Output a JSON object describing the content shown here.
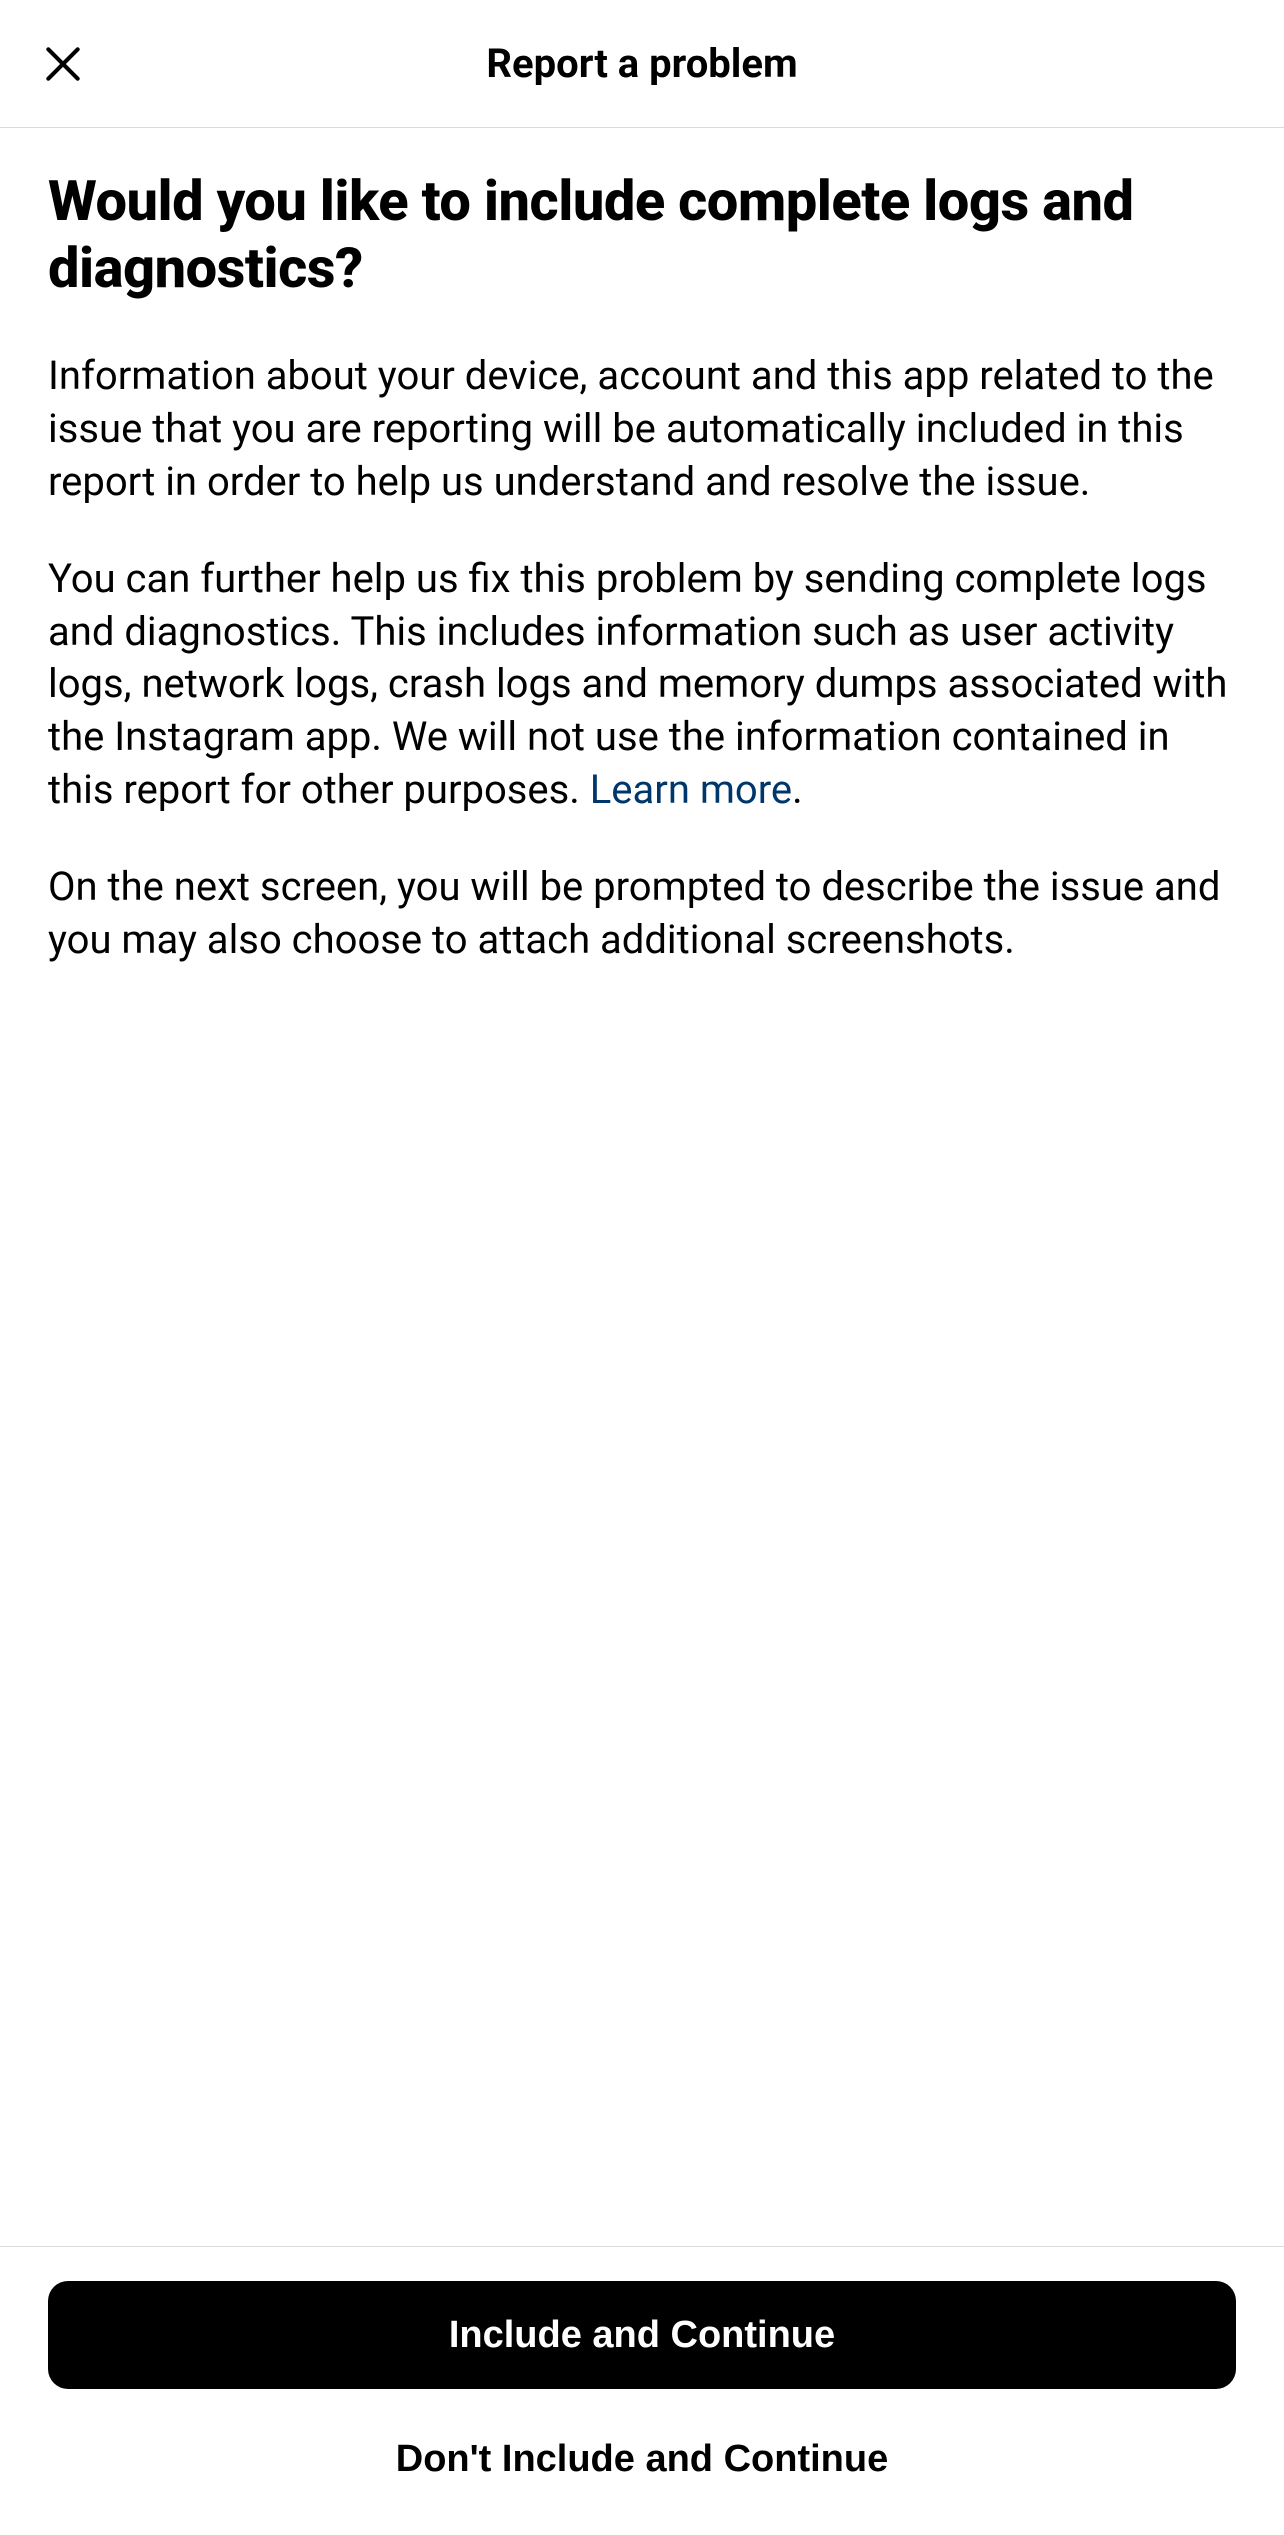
{
  "header": {
    "title": "Report a problem"
  },
  "main": {
    "heading": "Would you like to include complete logs and diagnostics?",
    "paragraph1": "Information about your device, account and this app related to the issue that you are reporting will be automatically included in this report in order to help us understand and resolve the issue.",
    "paragraph2_before_link": "You can further help us fix this problem by sending complete logs and diagnostics. This includes information such as user activity logs, network logs, crash logs and memory dumps associated with the Instagram app. We will not use the information contained in this report for other purposes. ",
    "paragraph2_link": "Learn more",
    "paragraph2_after_link": ".",
    "paragraph3": "On the next screen, you will be prompted to describe the issue and you may also choose to attach additional screenshots."
  },
  "footer": {
    "primary_button": "Include and Continue",
    "secondary_button": "Don't Include and Continue"
  }
}
